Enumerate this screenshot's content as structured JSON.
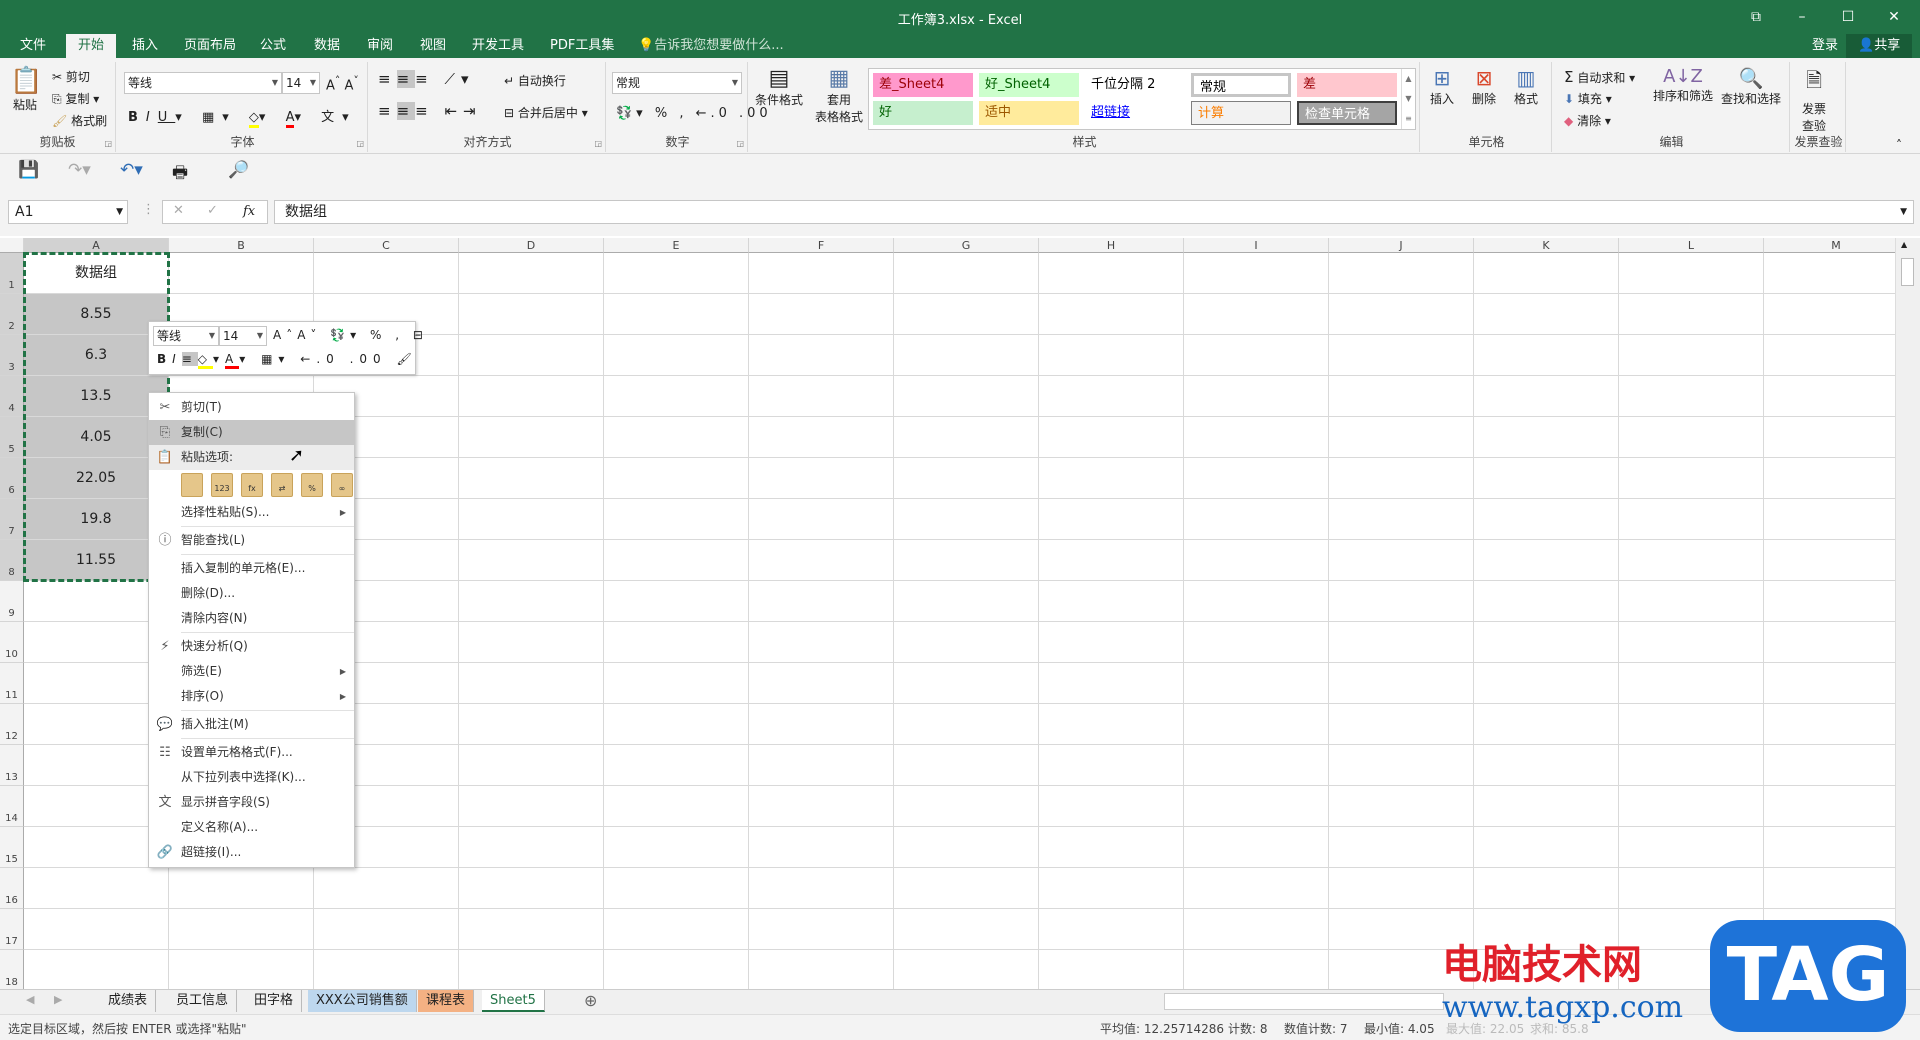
{
  "window": {
    "title": "工作簿3.xlsx - Excel",
    "controls": [
      "⧉",
      "–",
      "☐",
      "✕"
    ]
  },
  "tabs": [
    "文件",
    "开始",
    "插入",
    "页面布局",
    "公式",
    "数据",
    "审阅",
    "视图",
    "开发工具",
    "PDF工具集"
  ],
  "tell_me": "告诉我您想要做什么...",
  "account": {
    "login": "登录",
    "share": "共享"
  },
  "ribbon": {
    "clipboard": {
      "label": "剪贴板",
      "paste": "粘贴",
      "cut": "剪切",
      "copy": "复制",
      "format_painter": "格式刷"
    },
    "font": {
      "label": "字体",
      "name": "等线",
      "size": "14"
    },
    "alignment": {
      "label": "对齐方式",
      "wrap": "自动换行",
      "merge": "合并后居中"
    },
    "number": {
      "label": "数字",
      "format": "常规"
    },
    "styles": {
      "label": "样式",
      "conditional": "条件格式",
      "table": [
        "套用",
        "表格格式"
      ],
      "items": [
        {
          "text": "差_Sheet4",
          "bg": "#ff99cc",
          "fg": "#9c0006"
        },
        {
          "text": "好_Sheet4",
          "bg": "#ccffcc",
          "fg": "#006100"
        },
        {
          "text": "千位分隔 2",
          "bg": "#ffffff",
          "fg": "#000000"
        },
        {
          "text": "常规",
          "bg": "#ffffff",
          "fg": "#000000"
        },
        {
          "text": "差",
          "bg": "#ffc7ce",
          "fg": "#9c0006"
        },
        {
          "text": "好",
          "bg": "#c6efce",
          "fg": "#006100"
        },
        {
          "text": "适中",
          "bg": "#ffeb9c",
          "fg": "#9c5700"
        },
        {
          "text": "超链接",
          "bg": "#ffffff",
          "fg": "#0000ff"
        },
        {
          "text": "计算",
          "bg": "#f2f2f2",
          "fg": "#fa7d00"
        },
        {
          "text": "检查单元格",
          "bg": "#a5a5a5",
          "fg": "#ffffff"
        }
      ]
    },
    "cells": {
      "label": "单元格",
      "insert": "插入",
      "delete": "删除",
      "format": "格式"
    },
    "editing": {
      "label": "编辑",
      "autosum": "自动求和",
      "fill": "填充",
      "clear": "清除",
      "sort": "排序和筛选",
      "find": "查找和选择"
    },
    "invoice": {
      "label": "发票查验",
      "btn": [
        "发票",
        "查验"
      ]
    }
  },
  "formula_bar": {
    "name_box": "A1",
    "fx": "fx",
    "value": "数据组"
  },
  "sheet": {
    "columns": [
      "A",
      "B",
      "C",
      "D",
      "E",
      "F",
      "G",
      "H",
      "I",
      "J",
      "K",
      "L",
      "M"
    ],
    "rows": 18,
    "colA": [
      "数据组",
      "8.55",
      "6.3",
      "13.5",
      "4.05",
      "22.05",
      "19.8",
      "11.55"
    ]
  },
  "mini_toolbar": {
    "font": "等线",
    "size": "14"
  },
  "context_menu": [
    {
      "label": "剪切(T)",
      "icon": "✂"
    },
    {
      "label": "复制(C)",
      "icon": "⎘",
      "hl": true
    },
    {
      "label": "粘贴选项:",
      "icon": "📋"
    },
    {
      "paste": [
        "",
        "123",
        "fx",
        "⇄",
        "%",
        "∞"
      ]
    },
    {
      "label": "选择性粘贴(S)...",
      "sub": true
    },
    {
      "sep": true
    },
    {
      "label": "智能查找(L)",
      "icon": "ⓘ"
    },
    {
      "sep": true
    },
    {
      "label": "插入复制的单元格(E)..."
    },
    {
      "label": "删除(D)..."
    },
    {
      "label": "清除内容(N)"
    },
    {
      "sep": true
    },
    {
      "label": "快速分析(Q)",
      "icon": "⚡"
    },
    {
      "label": "筛选(E)",
      "sub": true
    },
    {
      "label": "排序(O)",
      "sub": true
    },
    {
      "sep": true
    },
    {
      "label": "插入批注(M)",
      "icon": "💬"
    },
    {
      "sep": true
    },
    {
      "label": "设置单元格格式(F)...",
      "icon": "☷"
    },
    {
      "label": "从下拉列表中选择(K)..."
    },
    {
      "label": "显示拼音字段(S)",
      "icon": "文"
    },
    {
      "label": "定义名称(A)..."
    },
    {
      "label": "超链接(I)...",
      "icon": "🔗"
    }
  ],
  "sheet_tabs": [
    {
      "name": "成绩表"
    },
    {
      "name": "员工信息"
    },
    {
      "name": "田字格"
    },
    {
      "name": "XXX公司销售额",
      "bg": "#bdd7ee"
    },
    {
      "name": "课程表",
      "bg": "#f4b183"
    },
    {
      "name": "Sheet5",
      "active": true
    }
  ],
  "status": {
    "message": "选定目标区域，然后按 ENTER 或选择\"粘贴\"",
    "average": "平均值: 12.25714286",
    "count": "计数: 8",
    "numcount": "数值计数: 7",
    "min": "最小值: 4.05",
    "max": "最大值: 22.05",
    "sum": "求和: 85.8"
  },
  "watermark": {
    "site_name": "电脑技术网",
    "url": "www.tagxp.com",
    "logo": "TAG"
  }
}
